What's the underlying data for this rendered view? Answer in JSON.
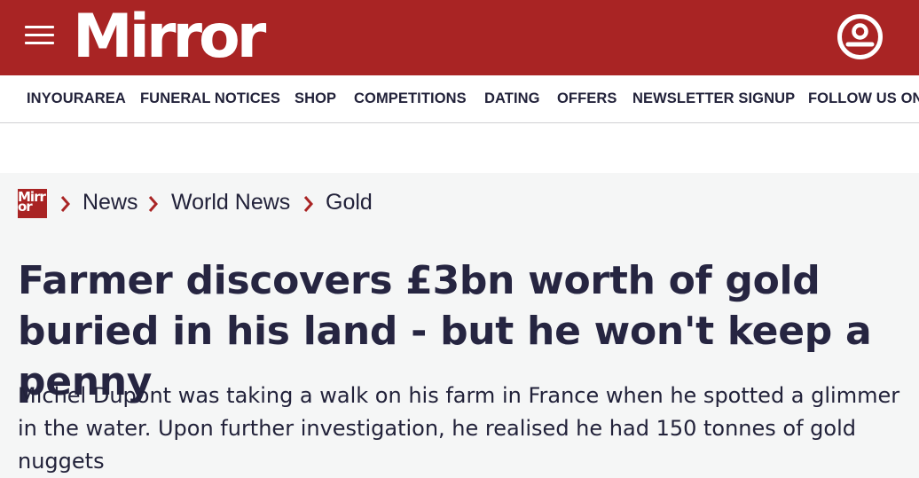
{
  "header": {
    "logo_text": "Mirror",
    "brand_color": "#a92424",
    "menu_icon": "hamburger-icon",
    "account_icon": "account-icon"
  },
  "nav": {
    "items": [
      {
        "label": "INYOURAREA"
      },
      {
        "label": "FUNERAL NOTICES"
      },
      {
        "label": "SHOP"
      },
      {
        "label": "COMPETITIONS"
      },
      {
        "label": "DATING"
      },
      {
        "label": "OFFERS"
      },
      {
        "label": "NEWSLETTER SIGNUP"
      },
      {
        "label": "FOLLOW US ON"
      }
    ]
  },
  "breadcrumb": {
    "logo_text": "Mirr or",
    "separator_icon": "chevron-right-icon",
    "items": [
      {
        "label": "News"
      },
      {
        "label": "World News"
      },
      {
        "label": "Gold"
      }
    ]
  },
  "article": {
    "headline": "Farmer discovers £3bn worth of gold buried in his land - but he won't keep a penny",
    "standfirst": "Michel Dupont was taking a walk on his farm in France when he spotted a glimmer in the water. Upon further investigation, he realised he had 150 tonnes of gold nuggets"
  }
}
